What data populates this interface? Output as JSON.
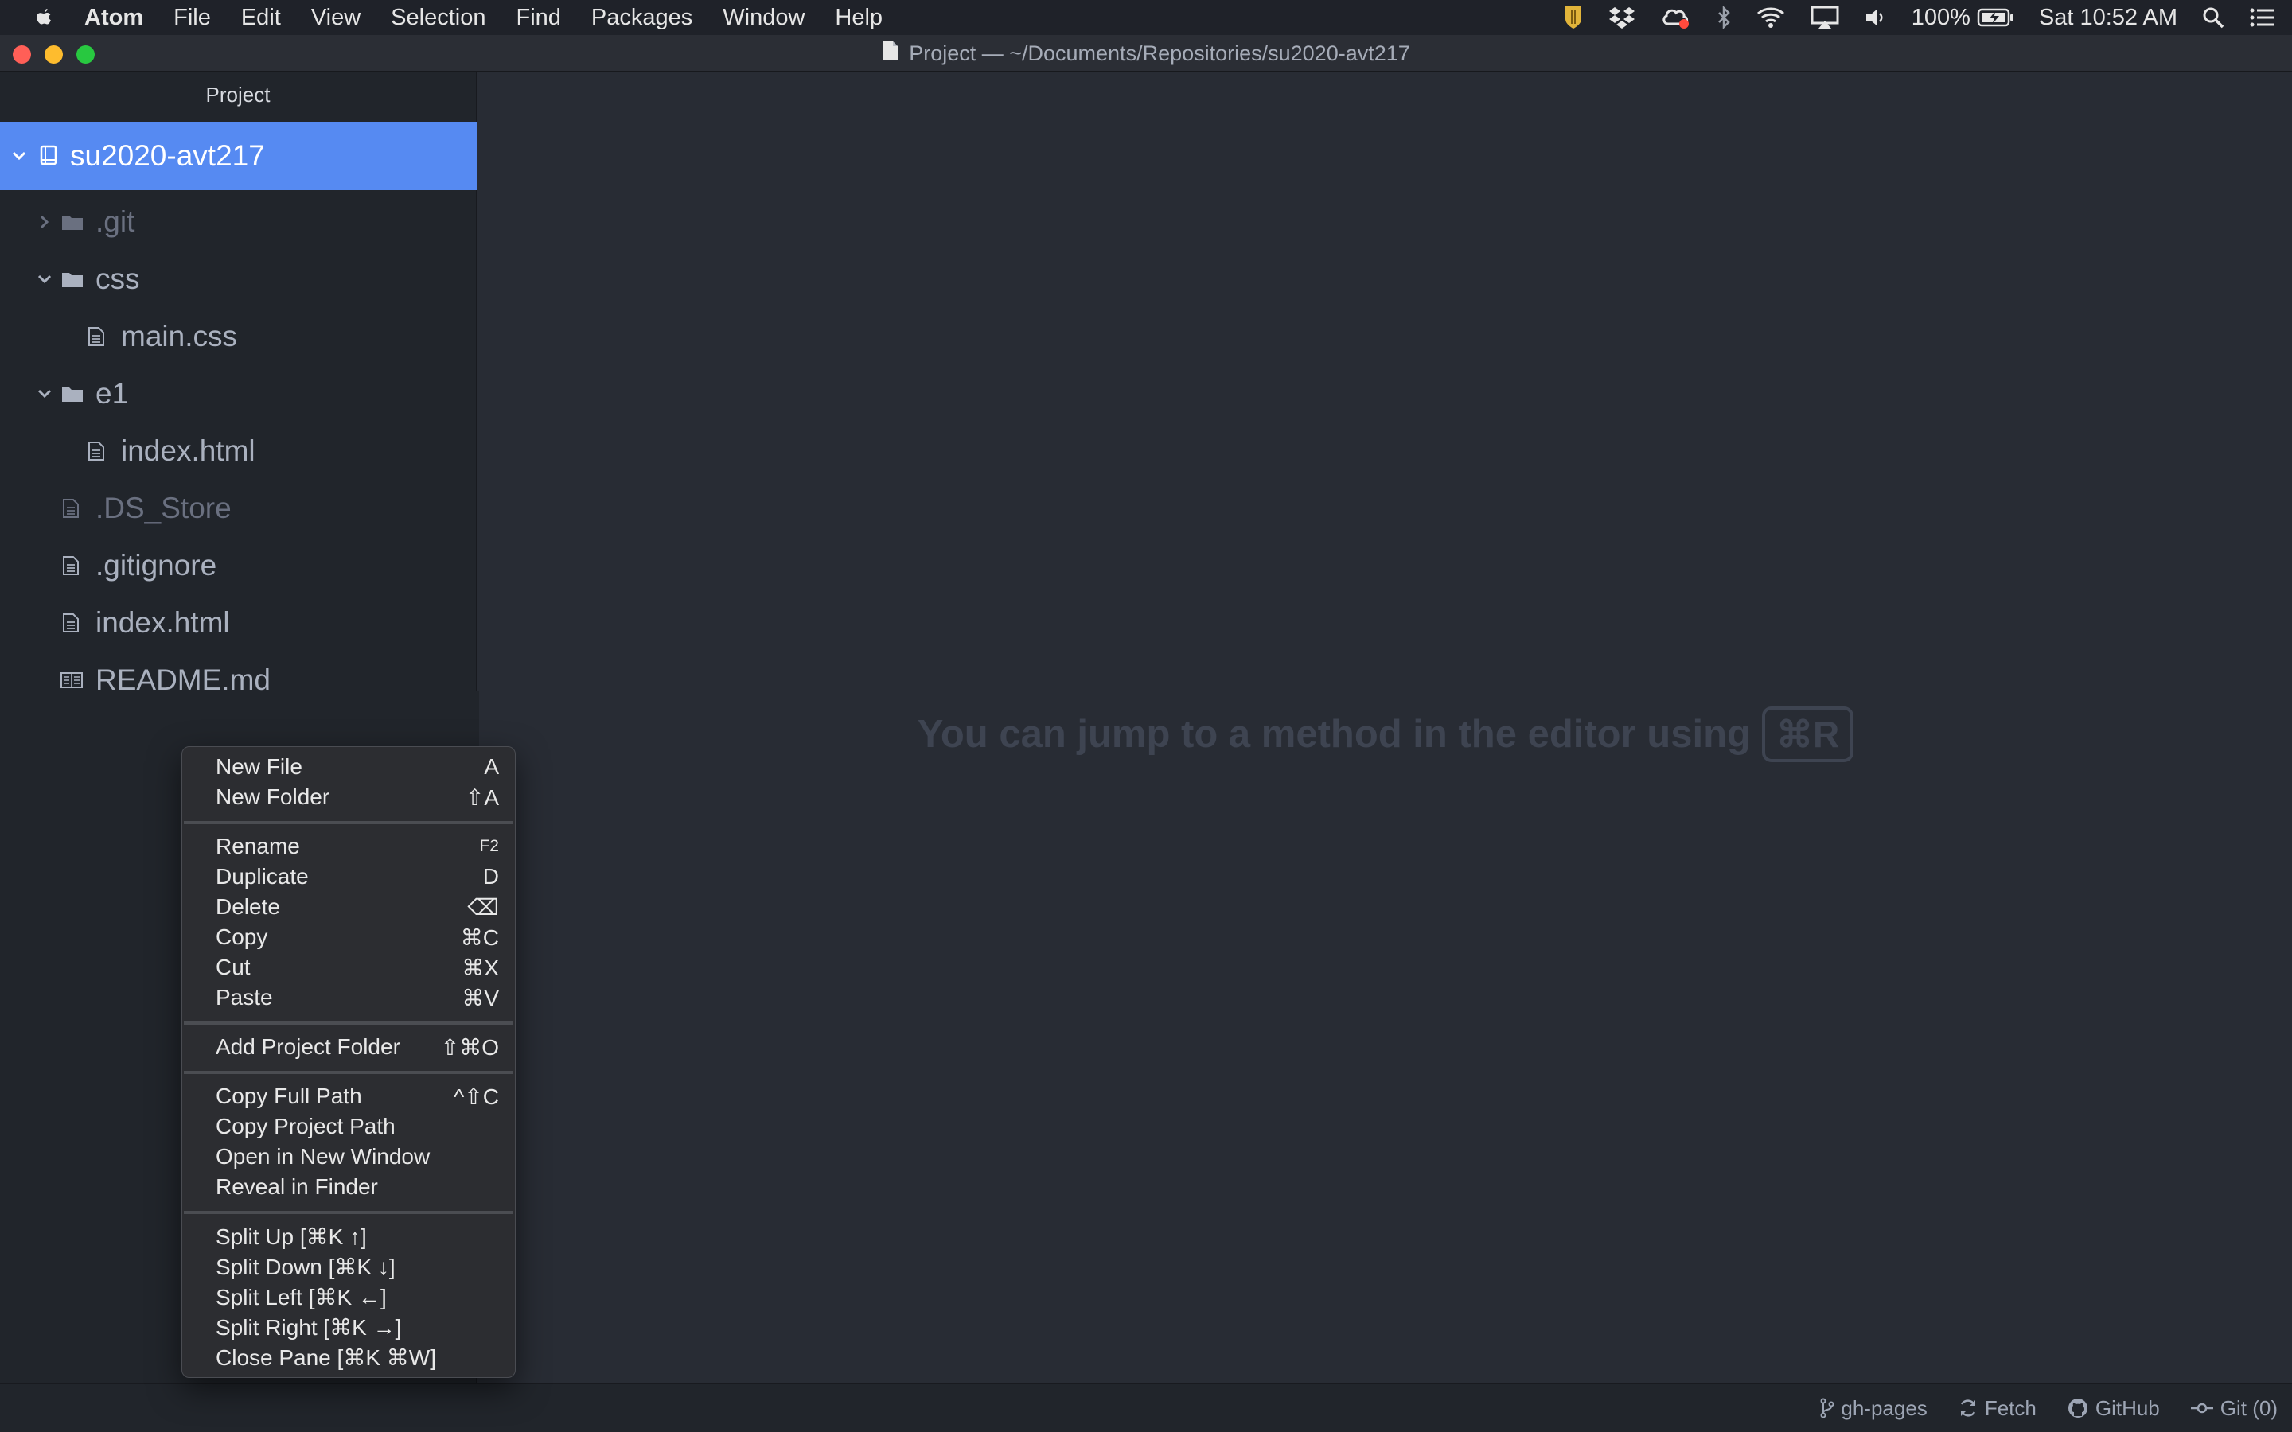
{
  "menubar": {
    "app": "Atom",
    "items": [
      "File",
      "Edit",
      "View",
      "Selection",
      "Find",
      "Packages",
      "Window",
      "Help"
    ],
    "battery": "100%",
    "clock": "Sat 10:52 AM",
    "status_icons": [
      "norton-icon",
      "dropbox-icon",
      "creative-cloud-icon",
      "bluetooth-icon",
      "wifi-icon",
      "airplay-icon",
      "volume-icon",
      "battery-icon",
      "spotlight-icon",
      "notification-center-icon"
    ]
  },
  "window": {
    "title": "Project — ~/Documents/Repositories/su2020-avt217"
  },
  "sidebar": {
    "header": "Project",
    "root": "su2020-avt217",
    "items": [
      {
        "label": ".git",
        "kind": "folder",
        "state": "collapsed",
        "dim": true
      },
      {
        "label": "css",
        "kind": "folder",
        "state": "expanded",
        "dim": false
      },
      {
        "label": "main.css",
        "kind": "file",
        "dim": false
      },
      {
        "label": "e1",
        "kind": "folder",
        "state": "expanded",
        "dim": false
      },
      {
        "label": "index.html",
        "kind": "file",
        "dim": false
      },
      {
        "label": ".DS_Store",
        "kind": "file",
        "dim": true
      },
      {
        "label": ".gitignore",
        "kind": "file",
        "dim": false
      },
      {
        "label": "index.html",
        "kind": "file",
        "dim": false
      },
      {
        "label": "README.md",
        "kind": "markdown",
        "dim": false
      }
    ]
  },
  "editor": {
    "hint": "You can jump to a method in the editor using",
    "hint_key": "⌘R"
  },
  "context_menu": {
    "items": [
      {
        "label": "New File",
        "shortcut": "A"
      },
      {
        "label": "New Folder",
        "shortcut": "⇧A"
      },
      {
        "label": "Rename",
        "shortcut": "F2"
      },
      {
        "label": "Duplicate",
        "shortcut": "D"
      },
      {
        "label": "Delete",
        "shortcut": "⌫"
      },
      {
        "label": "Copy",
        "shortcut": "⌘C"
      },
      {
        "label": "Cut",
        "shortcut": "⌘X"
      },
      {
        "label": "Paste",
        "shortcut": "⌘V"
      },
      {
        "label": "Add Project Folder",
        "shortcut": "⇧⌘O"
      },
      {
        "label": "Copy Full Path",
        "shortcut": "^⇧C"
      },
      {
        "label": "Copy Project Path",
        "shortcut": ""
      },
      {
        "label": "Open in New Window",
        "shortcut": ""
      },
      {
        "label": "Reveal in Finder",
        "shortcut": ""
      },
      {
        "label": "Split Up [⌘K ↑]",
        "shortcut": ""
      },
      {
        "label": "Split Down [⌘K ↓]",
        "shortcut": ""
      },
      {
        "label": "Split Left [⌘K ←]",
        "shortcut": ""
      },
      {
        "label": "Split Right [⌘K →]",
        "shortcut": ""
      },
      {
        "label": "Close Pane [⌘K ⌘W]",
        "shortcut": ""
      }
    ]
  },
  "statusbar": {
    "branch": "gh-pages",
    "fetch": "Fetch",
    "github": "GitHub",
    "git": "Git (0)"
  },
  "colors": {
    "selection": "#568af2",
    "sidebar_bg": "#21252b",
    "editor_bg": "#282c34",
    "traffic_close": "#ff5f57",
    "traffic_minimize": "#febc2e",
    "traffic_zoom": "#28c840"
  }
}
